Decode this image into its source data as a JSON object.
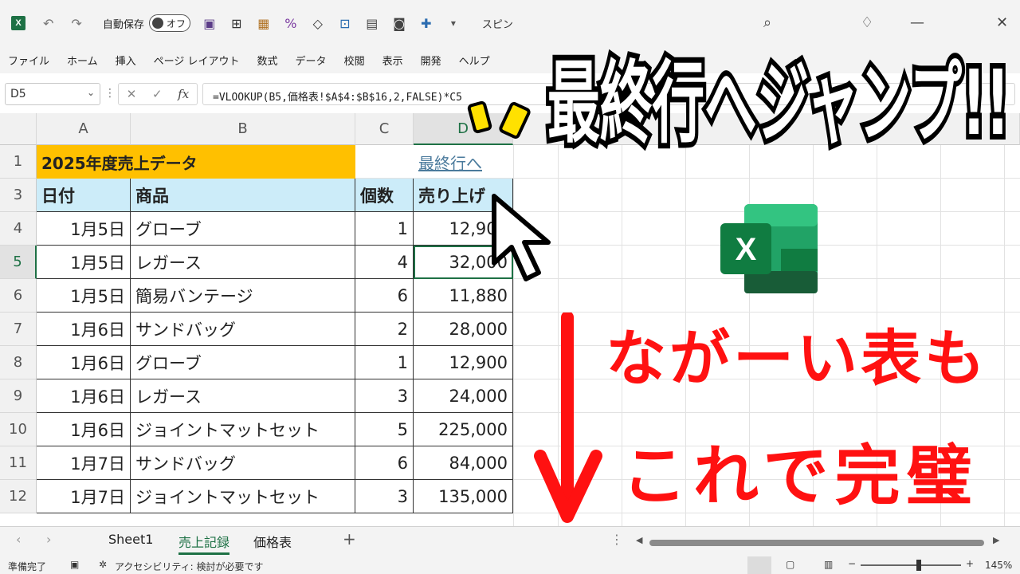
{
  "titlebar": {
    "app_icon": "excel-icon",
    "autosave_label": "自動保存",
    "autosave_state": "オフ",
    "doc_title": "スピン",
    "window_controls": [
      "minimize-icon",
      "maximize-icon",
      "close-icon"
    ]
  },
  "ribbon": {
    "tabs": [
      "ファイル",
      "ホーム",
      "挿入",
      "ページ レイアウト",
      "数式",
      "データ",
      "校閲",
      "表示",
      "開発",
      "ヘルプ"
    ]
  },
  "formula_bar": {
    "name_box": "D5",
    "fx": "fx",
    "formula": "=VLOOKUP(B5,価格表!$A$4:$B$16,2,FALSE)*C5"
  },
  "columns": [
    "A",
    "B",
    "C",
    "D"
  ],
  "rows": [
    {
      "num": "1",
      "a": "2025年度売上データ",
      "b": "",
      "c": "",
      "d": "最終行へ"
    },
    {
      "num": "3",
      "a": "日付",
      "b": "商品",
      "c": "個数",
      "d": "売り上げ"
    },
    {
      "num": "4",
      "a": "1月5日",
      "b": "グローブ",
      "c": "1",
      "d": "12,900"
    },
    {
      "num": "5",
      "a": "1月5日",
      "b": "レガース",
      "c": "4",
      "d": "32,000"
    },
    {
      "num": "6",
      "a": "1月5日",
      "b": "簡易バンテージ",
      "c": "6",
      "d": "11,880"
    },
    {
      "num": "7",
      "a": "1月6日",
      "b": "サンドバッグ",
      "c": "2",
      "d": "28,000"
    },
    {
      "num": "8",
      "a": "1月6日",
      "b": "グローブ",
      "c": "1",
      "d": "12,900"
    },
    {
      "num": "9",
      "a": "1月6日",
      "b": "レガース",
      "c": "3",
      "d": "24,000"
    },
    {
      "num": "10",
      "a": "1月6日",
      "b": "ジョイントマットセット",
      "c": "5",
      "d": "225,000"
    },
    {
      "num": "11",
      "a": "1月7日",
      "b": "サンドバッグ",
      "c": "6",
      "d": "84,000"
    },
    {
      "num": "12",
      "a": "1月7日",
      "b": "ジョイントマットセット",
      "c": "3",
      "d": "135,000"
    }
  ],
  "sheets": {
    "tabs": [
      "Sheet1",
      "売上記録",
      "価格表"
    ],
    "active": "売上記録",
    "add": "+"
  },
  "status": {
    "ready": "準備完了",
    "accessibility": "アクセシビリティ: 検討が必要です",
    "zoom": "145%"
  },
  "overlay": {
    "headline": "最終行へジャンプ!!",
    "caption_line1": "ながーい表も",
    "caption_line2": "これで完璧",
    "colors": {
      "red": "#ff1111",
      "header_orange": "#ffc000",
      "header_blue": "#ccecf9",
      "excel_green": "#1e7145"
    }
  }
}
